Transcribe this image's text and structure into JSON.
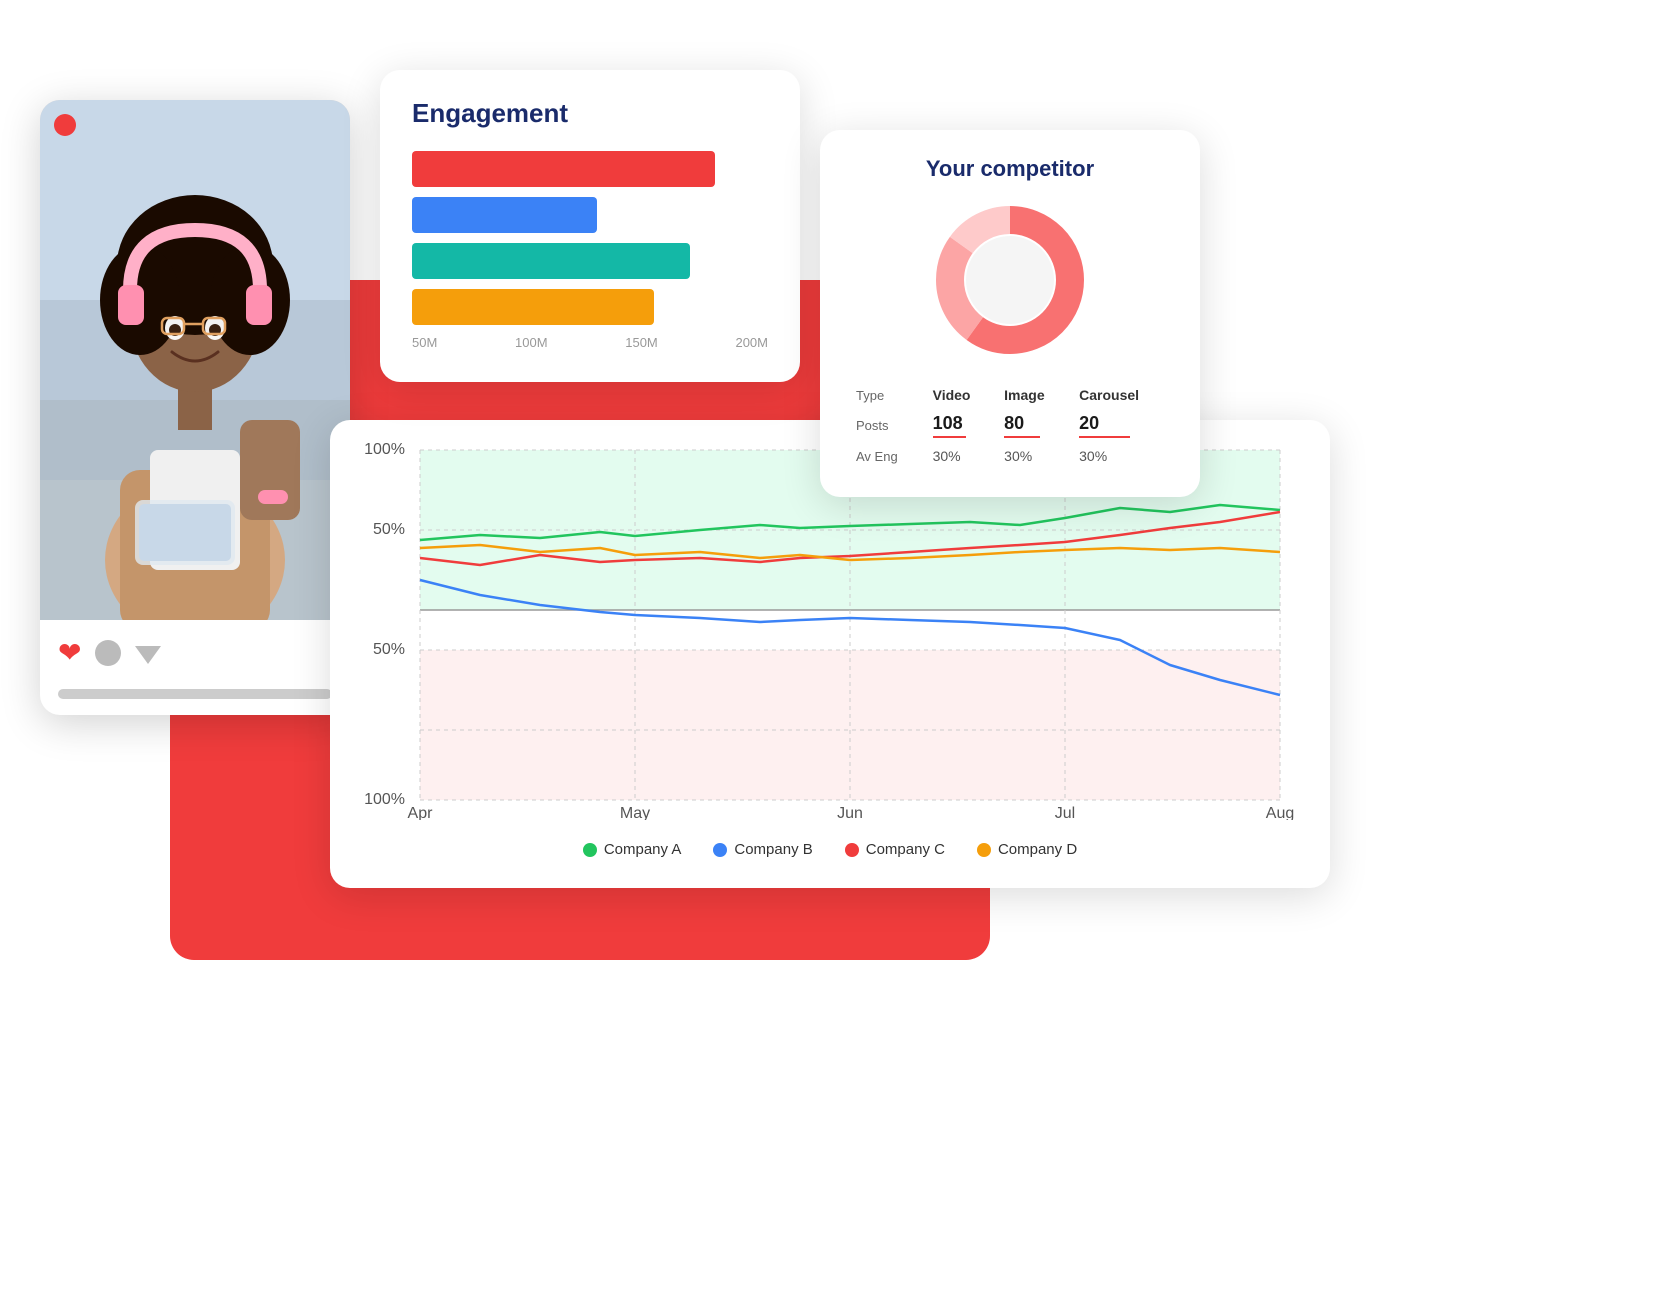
{
  "social_card": {
    "live_dot": "live",
    "heart_label": "❤",
    "bar_placeholder": ""
  },
  "engagement_card": {
    "title": "Engagement",
    "bars": [
      {
        "color": "red",
        "width_pct": 85
      },
      {
        "color": "blue",
        "width_pct": 52
      },
      {
        "color": "teal",
        "width_pct": 78
      },
      {
        "color": "yellow",
        "width_pct": 68
      }
    ],
    "axis_labels": [
      "50M",
      "100M",
      "150M",
      "200M"
    ]
  },
  "competitor_card": {
    "title": "Your competitor",
    "donut": {
      "segments": [
        {
          "color": "#f87171",
          "value": 60
        },
        {
          "color": "#fca5a5",
          "value": 20
        },
        {
          "color": "#fecaca",
          "value": 20
        }
      ]
    },
    "table": {
      "headers": [
        "Type",
        "Video",
        "Image",
        "Carousel"
      ],
      "rows": [
        {
          "label": "Posts",
          "values": [
            "108",
            "80",
            "20"
          ]
        },
        {
          "label": "Av Eng",
          "values": [
            "30%",
            "30%",
            "30%"
          ]
        }
      ]
    }
  },
  "line_chart": {
    "y_labels_top": [
      "100%",
      "50%"
    ],
    "y_labels_bottom": [
      "50%",
      "100%"
    ],
    "x_labels": [
      "Apr",
      "May",
      "Jun",
      "Jul",
      "Aug"
    ],
    "legend": [
      {
        "label": "Company A",
        "color": "#22c55e"
      },
      {
        "label": "Company B",
        "color": "#3b82f6"
      },
      {
        "label": "Company C",
        "color": "#f03c3c"
      },
      {
        "label": "Company D",
        "color": "#f59e0b"
      }
    ]
  }
}
